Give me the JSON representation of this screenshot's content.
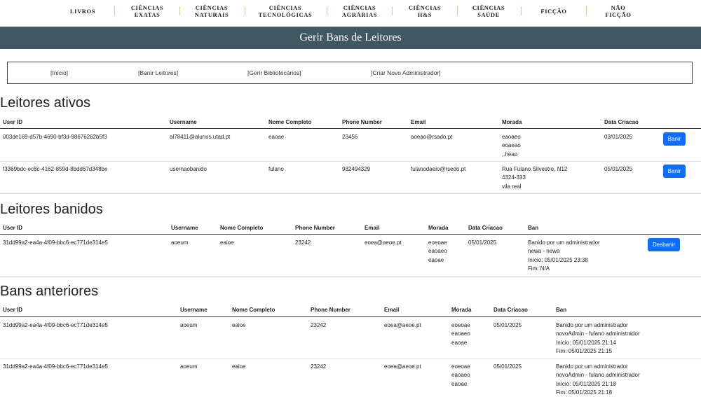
{
  "nav": [
    "LIVROS",
    "CIÊNCIAS\nEXATAS",
    "CIÊNCIAS\nNATURAIS",
    "CIÊNCIAS\nTECNOLÓGICAS",
    "CIÊNCIAS\nAGRÁRIAS",
    "CIÊNCIAS\nH&S",
    "CIÊNCIAS\nSAÚDE",
    "FICÇÃO",
    "NÃO\nFICÇÃO"
  ],
  "banner": "Gerir Bans de Leitores",
  "links": [
    "[Início]",
    "[Banir Leitores]",
    "[Gerir Bibliotecários]",
    "[Criar Novo Administrador]"
  ],
  "ativos": {
    "title": "Leitores ativos",
    "headers": [
      "User ID",
      "Username",
      "Nome Completo",
      "Phone Number",
      "Email",
      "Morada",
      "Data Criacao"
    ],
    "action_label": "Banir",
    "rows": [
      [
        "003de169-d57b-4690-bf3d-98676262b5f3",
        "al78411@alunos.utad.pt",
        "eaoae",
        "23456",
        "aoeao@rsado.pt",
        "eaoaeo\neoaeao\n,.heao",
        "03/01/2025"
      ],
      [
        "f3369bdc-ec8c-4162-859d-8bdd67d348be",
        "usernaobanido",
        "fulano",
        "932494329",
        "fulanodaeio@rsedo.pt",
        "Rua Fulano Silvestre, N12\n4324-333\nvila real",
        "05/01/2025"
      ]
    ]
  },
  "banidos": {
    "title": "Leitores banidos",
    "headers": [
      "User ID",
      "Username",
      "Nome Completo",
      "Phone Number",
      "Email",
      "Morada",
      "Data Criacao",
      "Ban"
    ],
    "action_label": "Desbanir",
    "rows": [
      [
        "31dd99a2-ea4a-4f09-bbc6-ec771de314e5",
        "aoeum",
        "eaioe",
        "23242",
        "eoea@aeoe.pt",
        "eoeoae\neaoaeo\neaoae",
        "05/01/2025",
        "Banido por um administrador\nnewa - newa\nInício: 05/01/2025 23:38\nFim: N/A"
      ]
    ]
  },
  "anteriores": {
    "title": "Bans anteriores",
    "headers": [
      "User ID",
      "Username",
      "Nome Completo",
      "Phone Number",
      "Email",
      "Morada",
      "Data Criacao",
      "Ban"
    ],
    "rows": [
      [
        "31dd99a2-ea4a-4f09-bbc6-ec771de314e5",
        "aoeum",
        "eaioe",
        "23242",
        "eoea@aeoe.pt",
        "eoeoae\neaoaeo\neaoae",
        "05/01/2025",
        "Banido por um administrador\nnovoAdmin - fulano administrador\nInício: 05/01/2025 21:14\nFim: 05/01/2025 21:15"
      ],
      [
        "31dd99a2-ea4a-4f09-bbc6-ec771de314e5",
        "aoeum",
        "eaioe",
        "23242",
        "eoea@aeoe.pt",
        "eoeoae\neaoaeo\neaoae",
        "05/01/2025",
        "Banido por um administrador\nnovoAdmin - fulano administrador\nInício: 05/01/2025 21:18\nFim: 05/01/2025 21:18"
      ]
    ]
  }
}
